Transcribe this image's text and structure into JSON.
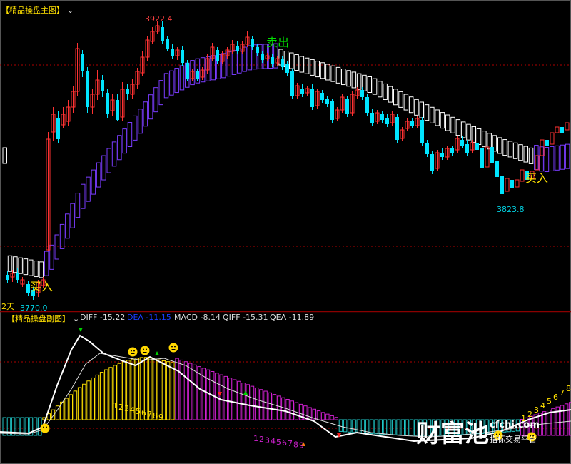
{
  "main_panel": {
    "title": "【精品操盘主图】",
    "high_label": "3922.4",
    "low_label_1": "3770.0",
    "low_label_2": "3823.8",
    "period_label": "2天",
    "buy_label_1": "买入",
    "buy_label_2": "买入",
    "sell_label": "卖出",
    "colors": {
      "up": "#ff3232",
      "down": "#00e5ff",
      "band_up": "#7a3cff",
      "band_down": "#ffffff",
      "high_text": "#ff4040",
      "low_text": "#00d0e0",
      "signal": "#ffe000",
      "sell_signal": "#00e000"
    }
  },
  "sub_panel": {
    "title": "【精品操盘副图】",
    "indicators": [
      {
        "name": "DIFF",
        "value": "-15.22",
        "color": "#ffffff"
      },
      {
        "name": "DEA",
        "value": "-11.15",
        "color": "#1a3cff"
      },
      {
        "name": "MACD",
        "value": "-8.14",
        "color": "#ffffff"
      },
      {
        "name": "QIFF",
        "value": "-15.31",
        "color": "#ffffff"
      },
      {
        "name": "QEA",
        "value": "-11.89",
        "color": "#ffffff"
      }
    ],
    "count_yellow": [
      "1",
      "2",
      "3",
      "4",
      "5",
      "6",
      "7",
      "8",
      "9"
    ],
    "count_magenta": [
      "1",
      "2",
      "3",
      "4",
      "5",
      "6",
      "7",
      "8",
      "9"
    ],
    "count_right": [
      "1",
      "2",
      "3",
      "4",
      "5",
      "6",
      "7",
      "8"
    ],
    "colors": {
      "yellow_bar": "#ffe000",
      "magenta_bar": "#d020d0",
      "cyan_bar": "#20c8c8"
    }
  },
  "watermark": {
    "logo": "财富池",
    "site": "cfchi.com",
    "tagline": "指标交易平台"
  }
}
